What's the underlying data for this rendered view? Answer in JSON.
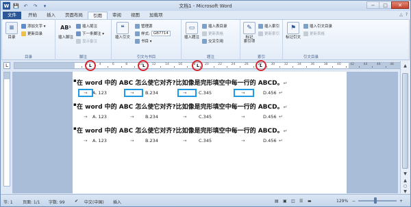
{
  "window": {
    "title": "文档1 - Microsoft Word",
    "logo": "W",
    "controls": {
      "minimize": "−",
      "maximize": "□",
      "close": "✕"
    }
  },
  "quick_access": {
    "save": "💾",
    "undo": "↶",
    "redo": "↷",
    "more": "▾"
  },
  "tabs": [
    "文件",
    "开始",
    "插入",
    "页面布局",
    "引用",
    "审阅",
    "视图",
    "加载项"
  ],
  "tab_right": {
    "minimize_ribbon": "△",
    "help": "?"
  },
  "ribbon": {
    "toc": {
      "big": "目录",
      "add_text": "添加文字 ▾",
      "update_toc": "更新目录",
      "label": "目录"
    },
    "footnotes": {
      "insert_footnote": "插入脚注",
      "ab_icon": "AB¹",
      "insert_endnote": "插入尾注",
      "next_footnote": "下一条脚注 ▾",
      "show_notes": "显示备注",
      "label": "脚注"
    },
    "citations": {
      "insert_citation": "插入引文",
      "manage_sources": "管理源",
      "style_label": "样式:",
      "style_value": "GB7714",
      "bibliography": "书目 ▾",
      "label": "引文与书目"
    },
    "captions": {
      "insert_caption": "插入题注",
      "insert_table_of_figures": "插入表目录",
      "update_table": "更新表格",
      "cross_reference": "交叉引用",
      "label": "题注"
    },
    "index": {
      "mark_entry": "标记\n索引项",
      "insert_index": "插入索引",
      "update_index": "更新索引",
      "label": "索引"
    },
    "toa": {
      "mark_citation": "标记引文",
      "insert_toa": "插入引文目录",
      "update_toa": "更新表格",
      "label": "引文目录"
    }
  },
  "ruler": {
    "tab_selector": "L",
    "numbers": [
      "2",
      "4",
      "6",
      "8",
      "10",
      "12",
      "14",
      "16",
      "18",
      "20",
      "22",
      "24",
      "26",
      "28",
      "30",
      "32",
      "34",
      "36",
      "38",
      "40",
      "42",
      "44",
      "46",
      "48"
    ]
  },
  "document": {
    "paragraphs": [
      {
        "question": "在 word 中的 ABC 怎么使它对齐?比如像是完形填空中每一行的 ABCD。",
        "a": "A.  123",
        "b": "B.234",
        "c": "C.345",
        "d": "D.456"
      },
      {
        "question": "在 word 中的 ABC 怎么使它对齐?比如像是完形填空中每一行的 ABCD。",
        "a": "A.  123",
        "b": "B.234",
        "c": "C.345",
        "d": "D.456"
      },
      {
        "question": "在 word 中的 ABC 怎么使它对齐?比如像是完形填空中每一行的 ABCD。",
        "a": "A.  123",
        "b": "B.234",
        "c": "C.345",
        "d": "D.456"
      }
    ],
    "para_mark": "↵",
    "tab_arrow": "→",
    "bullet": "▪"
  },
  "scrollbar": {
    "up": "▲",
    "down": "▼",
    "prev_page": "▲",
    "select_browse": "○",
    "next_page": "▼"
  },
  "status": {
    "page": "页面: 1/1",
    "words": "字数: 99",
    "language": "中文(中国)",
    "mode": "插入",
    "zoom": "129%",
    "zoom_out": "−",
    "zoom_in": "+",
    "section": "节: 1"
  },
  "colors": {
    "accent": "#2b5797",
    "highlight_box": "#1e9be0",
    "circle": "#d9262c"
  }
}
